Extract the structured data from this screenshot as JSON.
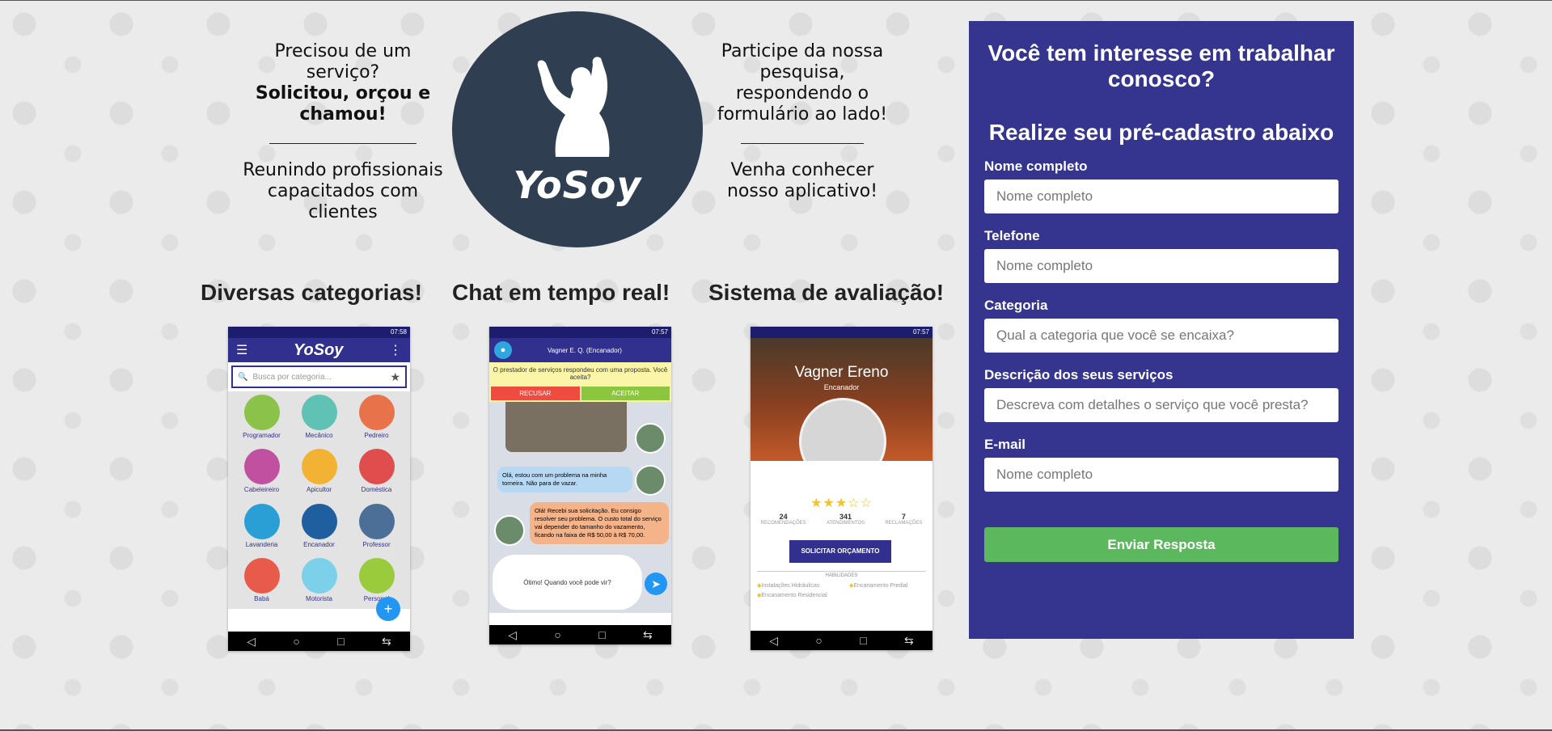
{
  "intro_left": {
    "line1": "Precisou de um serviço?",
    "line2": "Solicitou, orçou e chamou!",
    "line3": "Reunindo profissionais capacitados com clientes"
  },
  "logo": {
    "name": "YoSoy"
  },
  "intro_right": {
    "line1": "Participe da nossa pesquisa, respondendo o formulário ao lado!",
    "line2": "Venha conhecer nosso aplicativo!"
  },
  "features": [
    {
      "title": "Diversas categorias!"
    },
    {
      "title": "Chat em tempo real!"
    },
    {
      "title": "Sistema de avaliação!"
    }
  ],
  "phone_categories": {
    "time": "07:58",
    "app_title": "YoSoy",
    "search_placeholder": "Busca por categoria...",
    "categories": [
      "Programador",
      "Mecânico",
      "Pedreiro",
      "Cabeleireiro",
      "Apicultor",
      "Doméstica",
      "Lavanderia",
      "Encanador",
      "Professor",
      "Babá",
      "Motorista",
      "Personal"
    ],
    "fab": "+"
  },
  "phone_chat": {
    "time": "07:57",
    "contact": "Vagner E. Q. (Encanador)",
    "proposal": "O prestador de serviços respondeu com uma proposta. Você aceita?",
    "reject": "RECUSAR",
    "accept": "ACEITAR",
    "msg_user": "Olá, estou com um problema na minha torneira. Não para de vazar.",
    "msg_provider": "Olá! Recebi sua solicitação. Eu consigo resolver seu problema. O custo total do serviço vai depender do tamanho do vazamento, ficando na faixa de R$ 50,00 à R$ 70,00.",
    "input_text": "Ótimo! Quando você pode vir?"
  },
  "phone_rating": {
    "time": "07:57",
    "name": "Vagner Ereno",
    "role": "Encanador",
    "rating": 3,
    "stats": [
      {
        "value": "24",
        "label": "RECOMENDAÇÕES"
      },
      {
        "value": "341",
        "label": "ATENDIMENTOS"
      },
      {
        "value": "7",
        "label": "RECLAMAÇÕES"
      }
    ],
    "button": "SOLICITAR ORÇAMENTO",
    "skills_header": "HABILIDADES",
    "skills": [
      "Instalações Hidráulicas",
      "Encanamento Predial",
      "Encanamento Residencial"
    ]
  },
  "form": {
    "heading1": "Você tem interesse em trabalhar conosco?",
    "heading2": "Realize seu pré-cadastro abaixo",
    "fields": [
      {
        "label": "Nome completo",
        "placeholder": "Nome completo"
      },
      {
        "label": "Telefone",
        "placeholder": "Nome completo"
      },
      {
        "label": "Categoria",
        "placeholder": "Qual a categoria que você se encaixa?"
      },
      {
        "label": "Descrição dos seus serviços",
        "placeholder": "Descreva com detalhes o serviço que você presta?"
      },
      {
        "label": "E-mail",
        "placeholder": "Nome completo"
      }
    ],
    "submit": "Enviar Resposta"
  },
  "colors": {
    "form_bg": "#35358f",
    "submit_bg": "#5cb85c",
    "logo_circle": "#2f3e50",
    "app_primary": "#32308e"
  }
}
